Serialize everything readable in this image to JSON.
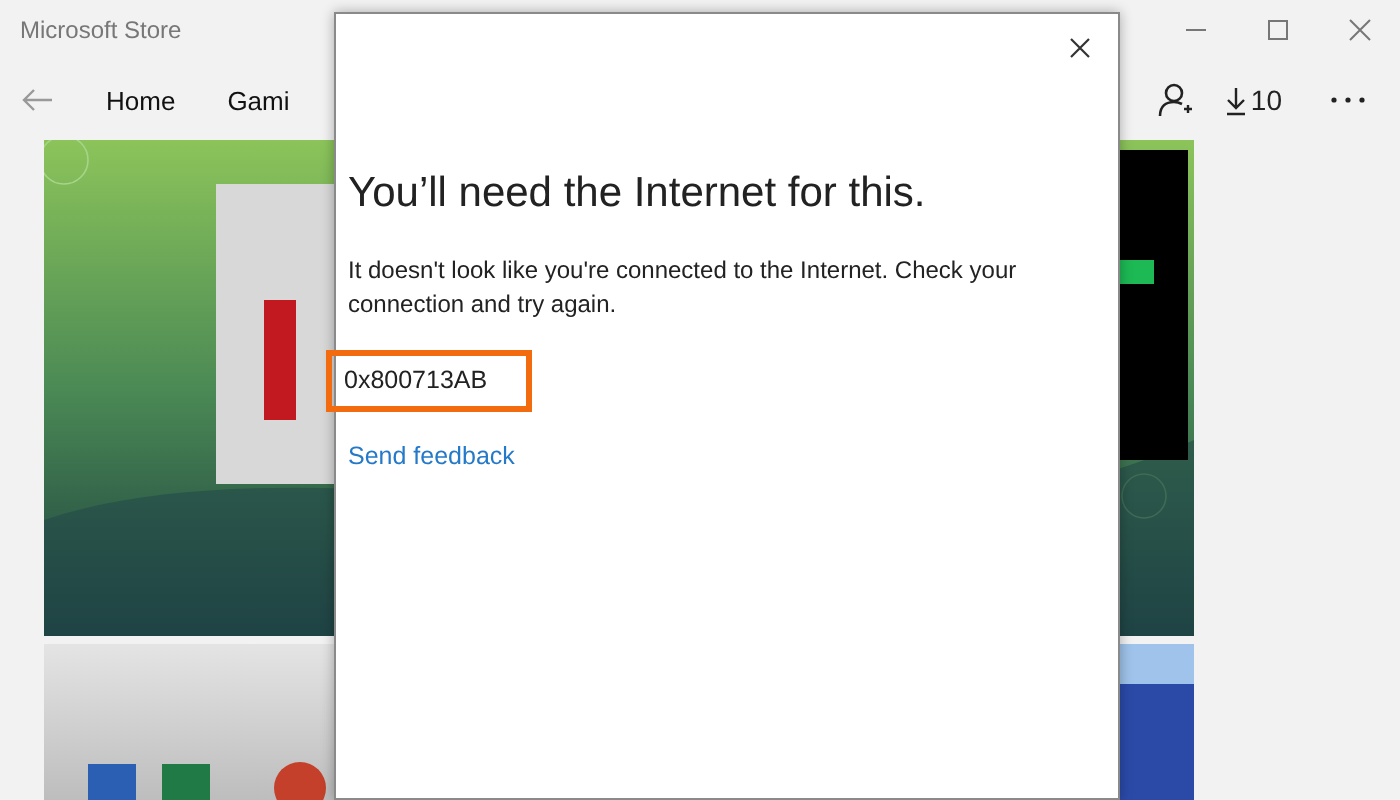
{
  "window": {
    "title": "Microsoft Store"
  },
  "nav": {
    "tabs": [
      {
        "label": "Home"
      },
      {
        "label": "Gami"
      }
    ],
    "downloads": "10"
  },
  "dialog": {
    "title": "You’ll need the Internet for this.",
    "message": "It doesn't look like you're connected to the Internet. Check your connection and try again.",
    "error_code": "0x800713AB",
    "link": "Send feedback"
  }
}
